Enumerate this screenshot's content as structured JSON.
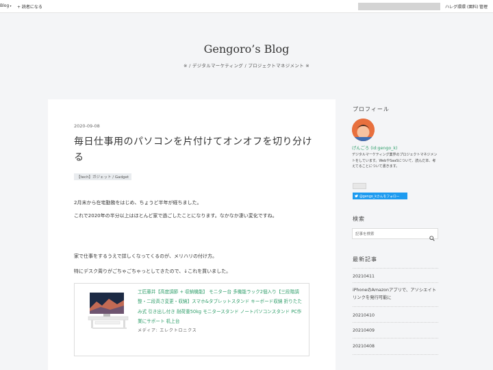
{
  "topbar": {
    "blog_menu": "Blog",
    "follow_label": "+ 読者になる",
    "right_text": "ハレグ環環 (面料)",
    "right_text2": "管理"
  },
  "header": {
    "title": "Gengoro’s Blog",
    "description": "※ / デジタルマーケティング / プロジェクトマネジメント ※"
  },
  "article": {
    "date": "2020-09-08",
    "title": "毎日仕事用のパソコンを片付けてオンオフを切り分ける",
    "category": "【tech】ガジェット / Gadget",
    "paragraphs": [
      "2月末から在宅勤務をはじめ、ちょうど半年が経ちました。",
      "これで2020年の半分以上はほとんど家で過ごしたことになります。なかなか凄い変化ですね。",
      "家で仕事をするうえで詳しくなってくるのが、メリハリの付け方。",
      "特にデスク周りがごちゃごちゃっとしてきたので、↓これを買いました。"
    ],
    "product": {
      "title": "工匠藤井【高度調節 + 収納機能】 モニター台 多機能ラック2個入り【三段階調整・二段高さ変更・収納】スマホ&タブレットスタンド キーボード収納 折りたたみ式 引き出し付き 耐荷重50kg モニタースタンド ノートパソコンスタンド PC作業にサポート 机上台",
      "maker": "メディア: エレクトロニクス"
    }
  },
  "sidebar": {
    "profile_heading": "プロフィール",
    "profile_name": "げんごろ (id:gengo_k)",
    "profile_bio": "デジタルマーケティング業界のプロジェクトマネジメントをしています。WebやSaaSについて、読んだ本、考えてることについて書きます。",
    "twitter_button": "@gengo_kさんをフォロー",
    "search_heading": "検索",
    "search_placeholder": "記事を検索",
    "recent_heading": "最新記事",
    "recent_items": [
      "20210411",
      "iPhoneのAmazonアプリで、アソシエイトリンクを発行可能に",
      "20210410",
      "20210409",
      "20210408"
    ]
  },
  "colors": {
    "accent_green": "#2f9e6a",
    "twitter_blue": "#1d9bf0",
    "background": "#f4f5f7"
  }
}
